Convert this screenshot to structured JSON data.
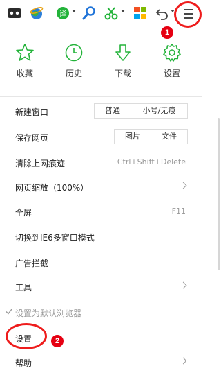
{
  "badges": {
    "one": "1",
    "two": "2"
  },
  "quick_actions": [
    {
      "label": "收藏",
      "icon": "star-icon"
    },
    {
      "label": "历史",
      "icon": "clock-icon"
    },
    {
      "label": "下载",
      "icon": "download-arrow-icon"
    },
    {
      "label": "设置",
      "icon": "gear-icon"
    }
  ],
  "menu": {
    "new_window": {
      "label": "新建窗口",
      "normal": "普通",
      "private": "小号/无痕"
    },
    "save_page": {
      "label": "保存网页",
      "image": "图片",
      "file": "文件"
    },
    "clear_history": {
      "label": "清除上网痕迹",
      "shortcut": "Ctrl+Shift+Delete"
    },
    "zoom": {
      "label": "网页缩放（100%）"
    },
    "fullscreen": {
      "label": "全屏",
      "shortcut": "F11"
    },
    "ie6_mode": {
      "label": "切换到IE6多窗口模式"
    },
    "ad_block": {
      "label": "广告拦截"
    },
    "tools": {
      "label": "工具"
    },
    "default_browser": {
      "label": "设置为默认浏览器"
    },
    "settings": {
      "label": "设置"
    },
    "help": {
      "label": "帮助"
    }
  },
  "colors": {
    "accent_green": "#23b33a",
    "annotation_red": "#ee1c1c"
  }
}
